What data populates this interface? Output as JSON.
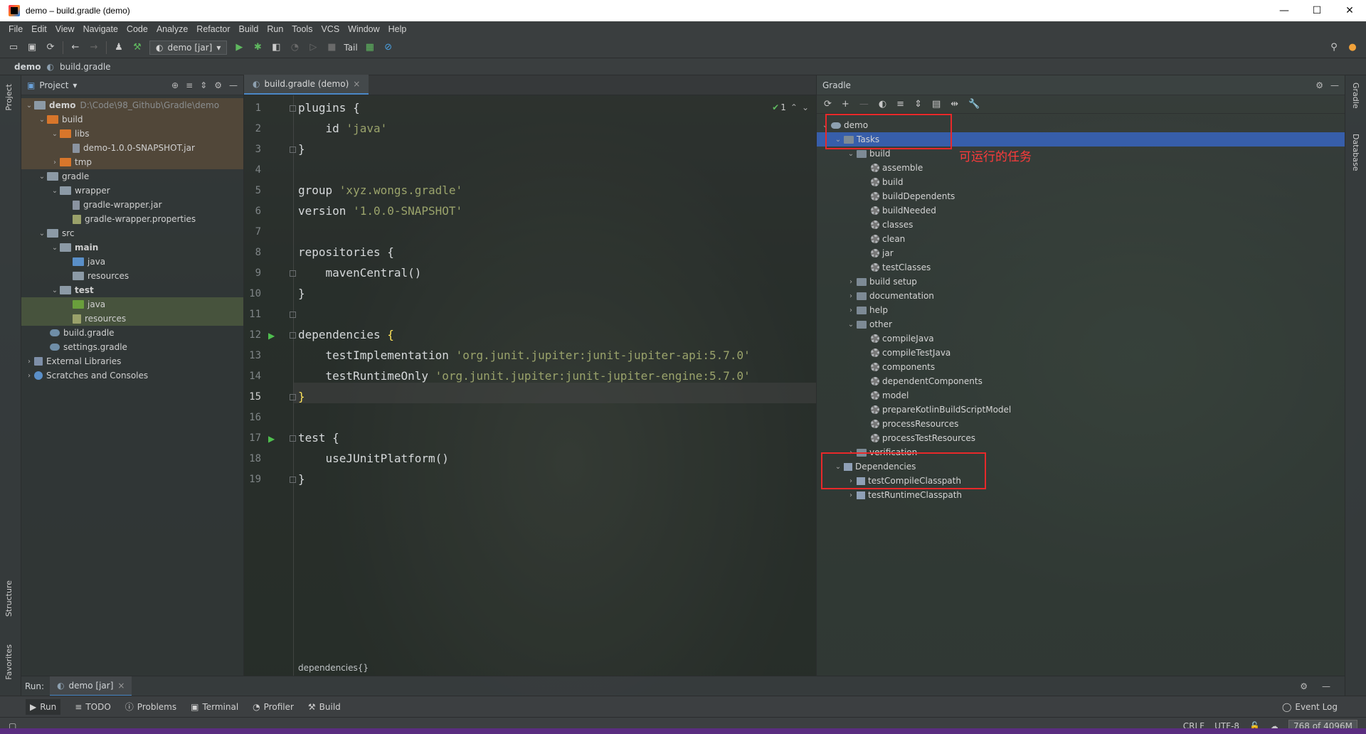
{
  "window": {
    "title": "demo – build.gradle (demo)",
    "controls": [
      "—",
      "☐",
      "✕"
    ]
  },
  "menu": [
    "File",
    "Edit",
    "View",
    "Navigate",
    "Code",
    "Analyze",
    "Refactor",
    "Build",
    "Run",
    "Tools",
    "VCS",
    "Window",
    "Help"
  ],
  "toolbar": {
    "run_config": "demo [jar]",
    "tail_label": "Tail"
  },
  "breadcrumb": {
    "project": "demo",
    "file": "build.gradle"
  },
  "project_panel": {
    "title": "Project",
    "rows": [
      {
        "label": "demo",
        "extra": "D:\\Code\\98_Github\\Gradle\\demo"
      },
      {
        "label": "build"
      },
      {
        "label": "libs"
      },
      {
        "label": "demo-1.0.0-SNAPSHOT.jar"
      },
      {
        "label": "tmp"
      },
      {
        "label": "gradle"
      },
      {
        "label": "wrapper"
      },
      {
        "label": "gradle-wrapper.jar"
      },
      {
        "label": "gradle-wrapper.properties"
      },
      {
        "label": "src"
      },
      {
        "label": "main"
      },
      {
        "label": "java"
      },
      {
        "label": "resources"
      },
      {
        "label": "test"
      },
      {
        "label": "java"
      },
      {
        "label": "resources"
      },
      {
        "label": "build.gradle"
      },
      {
        "label": "settings.gradle"
      },
      {
        "label": "External Libraries"
      },
      {
        "label": "Scratches and Consoles"
      }
    ]
  },
  "editor": {
    "tab": "build.gradle (demo)",
    "check_count": "1",
    "line_numbers": [
      "1",
      "2",
      "3",
      "4",
      "5",
      "6",
      "7",
      "8",
      "9",
      "10",
      "11",
      "12",
      "13",
      "14",
      "15",
      "16",
      "17",
      "18",
      "19"
    ],
    "lines": {
      "l1": "plugins {",
      "l2a": "    id ",
      "l2b": "'java'",
      "l3": "}",
      "l5a": "group ",
      "l5b": "'xyz.wongs.gradle'",
      "l6a": "version ",
      "l6b": "'1.0.0-SNAPSHOT'",
      "l8": "repositories {",
      "l9": "    mavenCentral()",
      "l10": "}",
      "l12a": "dependencies ",
      "l12b": "{",
      "l13a": "    testImplementation ",
      "l13b": "'org.junit.jupiter:junit-jupiter-api:5.7.0'",
      "l14a": "    testRuntimeOnly ",
      "l14b": "'org.junit.jupiter:junit-jupiter-engine:5.7.0'",
      "l15": "}",
      "l17": "test {",
      "l18": "    useJUnitPlatform()",
      "l19": "}"
    },
    "crumb": "dependencies{}"
  },
  "gradle_panel": {
    "title": "Gradle",
    "rows": [
      {
        "label": "demo"
      },
      {
        "label": "Tasks"
      },
      {
        "label": "build"
      },
      {
        "label": "assemble"
      },
      {
        "label": "build"
      },
      {
        "label": "buildDependents"
      },
      {
        "label": "buildNeeded"
      },
      {
        "label": "classes"
      },
      {
        "label": "clean"
      },
      {
        "label": "jar"
      },
      {
        "label": "testClasses"
      },
      {
        "label": "build setup"
      },
      {
        "label": "documentation"
      },
      {
        "label": "help"
      },
      {
        "label": "other"
      },
      {
        "label": "compileJava"
      },
      {
        "label": "compileTestJava"
      },
      {
        "label": "components"
      },
      {
        "label": "dependentComponents"
      },
      {
        "label": "model"
      },
      {
        "label": "prepareKotlinBuildScriptModel"
      },
      {
        "label": "processResources"
      },
      {
        "label": "processTestResources"
      },
      {
        "label": "verification"
      },
      {
        "label": "Dependencies"
      },
      {
        "label": "testCompileClasspath"
      },
      {
        "label": "testRuntimeClasspath"
      }
    ],
    "annotation": "可运行的任务"
  },
  "left_strip": {
    "project": "Project",
    "structure": "Structure",
    "favorites": "Favorites"
  },
  "right_strip": {
    "gradle": "Gradle",
    "database": "Database"
  },
  "run_bar": {
    "label": "Run:",
    "tab": "demo [jar]"
  },
  "tool_windows": {
    "run": "Run",
    "todo": "TODO",
    "problems": "Problems",
    "terminal": "Terminal",
    "profiler": "Profiler",
    "build": "Build",
    "event_log": "Event Log"
  },
  "status": {
    "line_sep": "CRLF",
    "encoding": "UTF-8",
    "memory": "768 of 4096M"
  }
}
